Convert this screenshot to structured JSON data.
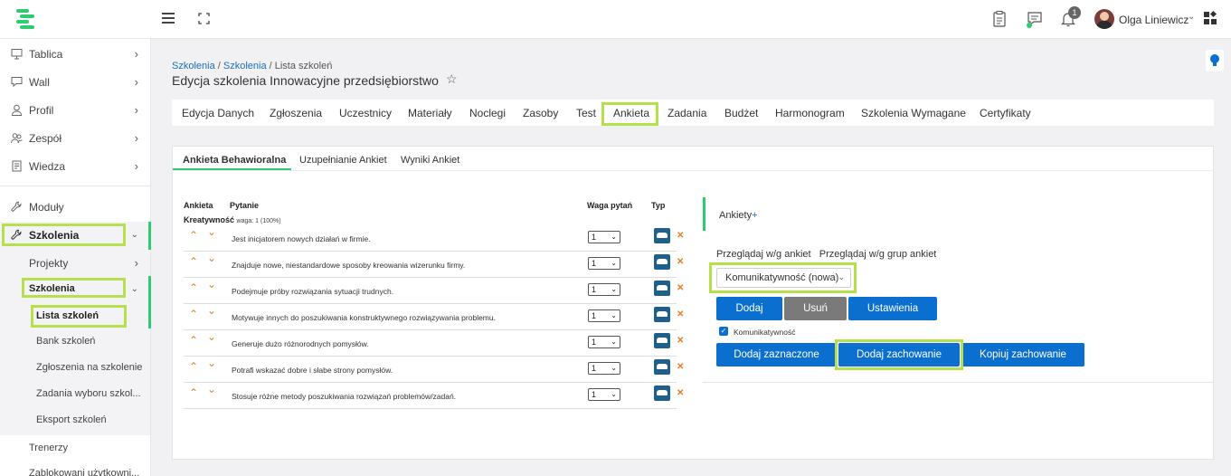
{
  "header": {
    "user_name": "Olga Liniewicz",
    "notification_count": "1",
    "icons": [
      "menu-icon",
      "fullscreen-icon",
      "clipboard-icon",
      "chat-icon",
      "bell-icon",
      "avatar",
      "apps-grid-icon"
    ]
  },
  "sidebar": {
    "items": [
      {
        "label": "Tablica",
        "icon": "monitor-icon"
      },
      {
        "label": "Wall",
        "icon": "chat-icon"
      },
      {
        "label": "Profil",
        "icon": "user-icon"
      },
      {
        "label": "Zespół",
        "icon": "team-icon"
      },
      {
        "label": "Wiedza",
        "icon": "book-icon"
      },
      {
        "label": "Moduły",
        "icon": "wrench-icon"
      },
      {
        "label": "Szkolenia",
        "icon": "wrench-icon"
      }
    ],
    "sub": {
      "projekty": "Projekty",
      "szkolenia": "Szkolenia",
      "lista": "Lista szkoleń",
      "bank": "Bank szkoleń",
      "zgloszenia": "Zgłoszenia na szkolenie",
      "zadania": "Zadania wyboru szkol...",
      "eksport": "Eksport szkoleń",
      "trenerzy": "Trenerzy",
      "zablokowani": "Zablokowani użytkowni..."
    }
  },
  "breadcrumb": {
    "part1": "Szkolenia",
    "sep": " / ",
    "part2": "Szkolenia",
    "part3": "Lista szkoleń"
  },
  "page_title": "Edycja szkolenia Innowacyjne przedsiębiorstwo",
  "tabs": [
    "Edycja Danych",
    "Zgłoszenia",
    "Uczestnicy",
    "Materiały",
    "Noclegi",
    "Zasoby",
    "Test",
    "Ankieta",
    "Zadania",
    "Budżet",
    "Harmonogram",
    "Szkolenia Wymagane",
    "Certyfikaty"
  ],
  "subtabs": [
    "Ankieta Behawioralna",
    "Uzupełnianie Ankiet",
    "Wyniki Ankiet"
  ],
  "table": {
    "headers": {
      "ankieta": "Ankieta",
      "pytanie": "Pytanie",
      "waga": "Waga pytań",
      "typ": "Typ"
    },
    "category": "Kreatywność",
    "category_weight": "waga: 1 (100%)",
    "rows": [
      {
        "question": "Jest inicjatorem nowych działań w firmie.",
        "weight": "1"
      },
      {
        "question": "Znajduje nowe, niestandardowe sposoby kreowania wizerunku firmy.",
        "weight": "1"
      },
      {
        "question": "Podejmuje próby rozwiązania sytuacji trudnych.",
        "weight": "1"
      },
      {
        "question": "Motywuje innych do poszukiwania konstruktywnego rozwiązywania problemu.",
        "weight": "1"
      },
      {
        "question": "Generuje dużo różnorodnych pomysłów.",
        "weight": "1"
      },
      {
        "question": "Potrafi wskazać dobre i słabe strony pomysłów.",
        "weight": "1"
      },
      {
        "question": "Stosuje różne metody poszukiwania rozwiązań problemów/zadań.",
        "weight": "1"
      }
    ]
  },
  "surveys": {
    "title": "Ankiety",
    "plus": "+",
    "browse_by_survey": "Przeglądaj w/g ankiet",
    "browse_by_group": "Przeglądaj w/g grup ankiet",
    "selected_survey": "Komunikatywność (nowa)",
    "btn_add": "Dodaj",
    "btn_remove": "Usuń",
    "btn_settings": "Ustawienia",
    "checkbox_label": "Komunikatywność",
    "btn_add_selected": "Dodaj zaznaczone",
    "btn_add_behavior": "Dodaj zachowanie",
    "btn_copy_behavior": "Kopiuj zachowanie"
  },
  "colors": {
    "accent_green": "#2ecc71",
    "highlight": "#b5e04b",
    "button_blue": "#0b6fcf",
    "link_blue": "#1a6fb5",
    "arrow_orange": "#e67e22"
  }
}
